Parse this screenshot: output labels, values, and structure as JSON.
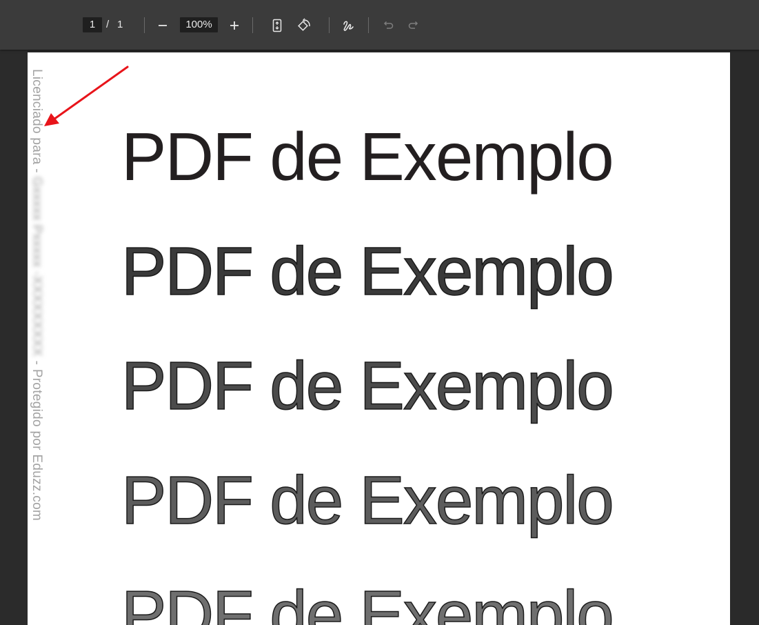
{
  "toolbar": {
    "current_page": "1",
    "page_separator": "/",
    "total_pages": "1",
    "zoom_value": "100%"
  },
  "document": {
    "watermark": {
      "prefix": "Licenciado para - ",
      "blurred_name": "Gxxxxx Pxxxxx - ",
      "blurred_id": "XXXXXXXXX",
      "suffix": " - Protegido por Eduzz.com"
    },
    "lines": [
      "PDF de Exemplo",
      "PDF de Exemplo",
      "PDF de Exemplo",
      "PDF de Exemplo",
      "PDF de Exemplo"
    ]
  },
  "colors": {
    "toolbar_bg": "#3b3b3b",
    "viewer_bg": "#282828",
    "page_bg": "#ffffff",
    "annotation_arrow": "#e8141a",
    "watermark_text": "#a3a3a3"
  },
  "icons": [
    "minus-icon",
    "plus-icon",
    "fit-page-icon",
    "rotate-icon",
    "draw-icon",
    "undo-icon",
    "redo-icon"
  ]
}
